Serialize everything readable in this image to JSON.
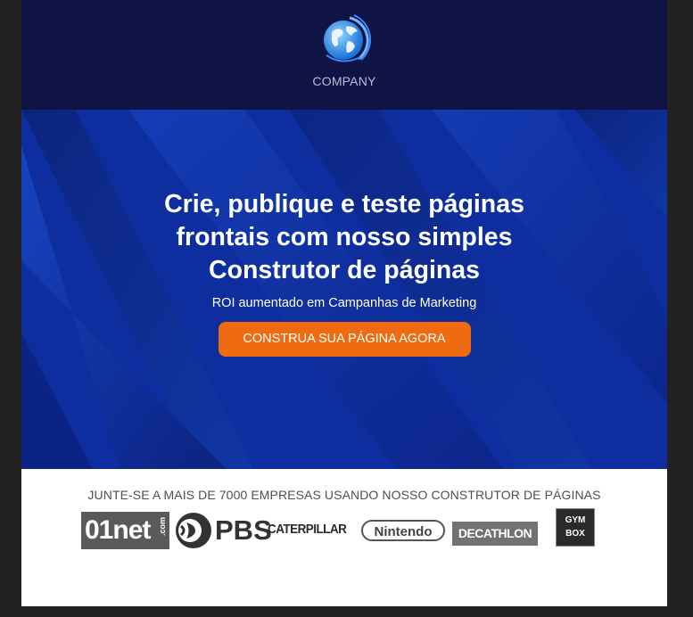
{
  "logo": {
    "text": "COMPANY",
    "icon": "globe-icon"
  },
  "hero": {
    "headline": "Crie, publique e teste páginas frontais com nosso simples Construtor de páginas",
    "subtitle": "ROI aumentado em Campanhas de Marketing",
    "cta_label": "CONSTRUA SUA PÁGINA AGORA"
  },
  "brands": {
    "title": "JUNTE-SE A MAIS DE 7000 EMPRESAS USANDO NOSSO CONSTRUTOR DE PÁGINAS",
    "items": [
      {
        "name": "01net",
        "suffix": ".com"
      },
      {
        "name": "PBS"
      },
      {
        "name": "CATERPILLAR"
      },
      {
        "name": "Nintendo"
      },
      {
        "name": "DECATHLON"
      },
      {
        "name": "GYM",
        "line2": "BOX"
      }
    ]
  },
  "colors": {
    "page_background": "#222222",
    "header_background": "#0f1444",
    "hero_background": "#0d2a96",
    "cta_background": "#f06a0f",
    "brands_text": "#4f4f4f"
  }
}
